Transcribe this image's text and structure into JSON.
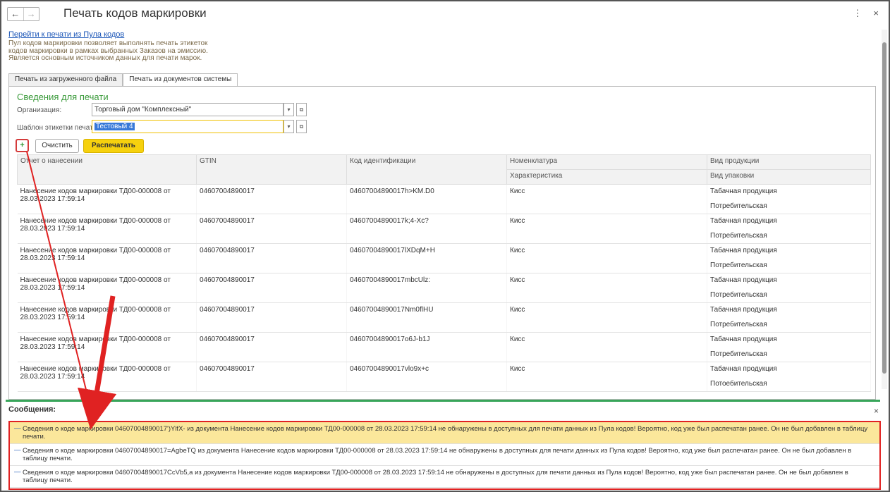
{
  "window": {
    "title": "Печать кодов маркировки",
    "back": "←",
    "forward": "→",
    "more_icon": "⋮",
    "close_icon": "×"
  },
  "link": "Перейти к печати из Пула кодов",
  "description": [
    "Пул кодов маркировки позволяет выполнять печать этикеток",
    "кодов маркировки в рамках выбранных Заказов на эмиссию.",
    "Является основным источником данных для печати марок."
  ],
  "tabs": [
    {
      "label": "Печать из загруженного файла"
    },
    {
      "label": "Печать из документов системы"
    }
  ],
  "form": {
    "section_title": "Сведения для печати",
    "org_label": "Организация:",
    "org_value": "Торговый дом \"Комплексный\"",
    "template_label": "Шаблон этикетки печати:",
    "template_value": "Тестовый 4",
    "dd_icon": "▾",
    "open_icon": "⧉"
  },
  "buttons": {
    "clear": "Очистить",
    "print": "Распечатать"
  },
  "table": {
    "headers": {
      "report": "Отчет о нанесении",
      "gtin": "GTIN",
      "code": "Код идентификации",
      "nomenclature": "Номенклатура",
      "characteristic": "Характеристика",
      "product_type": "Вид продукции",
      "package_type": "Вид упаковки"
    },
    "rows": [
      {
        "report": "Нанесение кодов маркировки ТД00-000008 от 28.03.2023 17:59:14",
        "gtin": "04607004890017",
        "code": "04607004890017h>KM.D0",
        "nom": "Кисс",
        "ptype": "Табачная продукция",
        "pack": "Потребительская"
      },
      {
        "report": "Нанесение кодов маркировки ТД00-000008 от 28.03.2023 17:59:14",
        "gtin": "04607004890017",
        "code": "04607004890017k;4-Xc?",
        "nom": "Кисс",
        "ptype": "Табачная продукция",
        "pack": "Потребительская"
      },
      {
        "report": "Нанесение кодов маркировки ТД00-000008 от 28.03.2023 17:59:14",
        "gtin": "04607004890017",
        "code": "04607004890017lXDqM+H",
        "nom": "Кисс",
        "ptype": "Табачная продукция",
        "pack": "Потребительская"
      },
      {
        "report": "Нанесение кодов маркировки ТД00-000008 от 28.03.2023 17:59:14",
        "gtin": "04607004890017",
        "code": "04607004890017mbcUlz:",
        "nom": "Кисс",
        "ptype": "Табачная продукция",
        "pack": "Потребительская"
      },
      {
        "report": "Нанесение кодов маркировки ТД00-000008 от 28.03.2023 17:59:14",
        "gtin": "04607004890017",
        "code": "04607004890017Nm0flHU",
        "nom": "Кисс",
        "ptype": "Табачная продукция",
        "pack": "Потребительская"
      },
      {
        "report": "Нанесение кодов маркировки ТД00-000008 от 28.03.2023 17:59:14",
        "gtin": "04607004890017",
        "code": "04607004890017o6J-b1J",
        "nom": "Кисс",
        "ptype": "Табачная продукция",
        "pack": "Потребительская"
      },
      {
        "report": "Нанесение кодов маркировки ТД00-000008 от 28.03.2023 17:59:14",
        "gtin": "04607004890017",
        "code": "04607004890017vlo9x+c",
        "nom": "Кисс",
        "ptype": "Табачная продукция",
        "pack": "Потоебительская"
      }
    ]
  },
  "messages": {
    "title": "Сообщения:",
    "close_icon": "×",
    "dash": "—",
    "items": [
      "Сведения о коде маркировки 04607004890017')YlfX- из документа Нанесение кодов маркировки ТД00-000008 от 28.03.2023 17:59:14 не обнаружены в доступных для печати данных из Пула кодов! Вероятно, код уже был распечатан ранее. Он не был добавлен в таблицу печати.",
      "Сведения о коде маркировки 04607004890017=AgbeTQ из документа Нанесение кодов маркировки ТД00-000008 от 28.03.2023 17:59:14 не обнаружены в доступных для печати данных из Пула кодов! Вероятно, код уже был распечатан ранее. Он не был добавлен в таблицу печати.",
      "Сведения о коде маркировки 04607004890017CcVb5,а из документа Нанесение кодов маркировки ТД00-000008 от 28.03.2023 17:59:14 не обнаружены в доступных для печати данных из Пула кодов! Вероятно, код уже был распечатан ранее. Он не был добавлен в таблицу печати."
    ]
  },
  "colors": {
    "accent_green": "#3a9a3a",
    "annotation_red": "#e02222",
    "print_button": "#f6d10e",
    "highlight": "#fbe79b"
  }
}
